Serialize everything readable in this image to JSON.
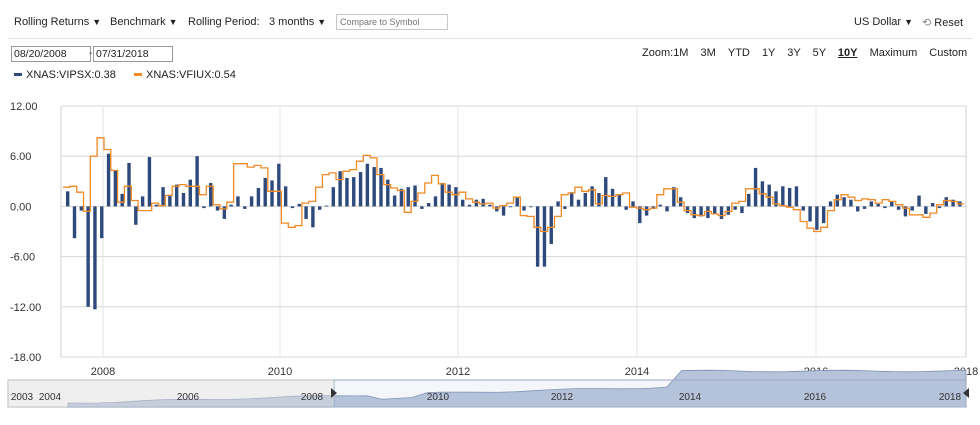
{
  "toolbar": {
    "rolling_returns": "Rolling Returns",
    "benchmark": "Benchmark",
    "rolling_period_label": "Rolling Period:",
    "rolling_period_value": "3 months",
    "compare_placeholder": "Compare to Symbol",
    "currency": "US Dollar",
    "reset": "Reset"
  },
  "dates": {
    "start": "08/20/2008",
    "end": "07/31/2018"
  },
  "zoom": {
    "label": "Zoom:",
    "options": [
      "1M",
      "3M",
      "YTD",
      "1Y",
      "3Y",
      "5Y",
      "10Y",
      "Maximum",
      "Custom"
    ],
    "active": "10Y"
  },
  "legend": [
    {
      "label": "XNAS:VIPSX:0.38",
      "color": "#2e4a7d"
    },
    {
      "label": "XNAS:VFIUX:0.54",
      "color": "#f08a24"
    }
  ],
  "colors": {
    "vipsx": "#2e4a7d",
    "vfiux": "#f08a24",
    "navigator_fill": "#b6c3da"
  },
  "chart_data": {
    "type": "bar",
    "title": "",
    "xlabel": "",
    "ylabel": "",
    "ylim": [
      -18,
      12
    ],
    "y_ticks": [
      "12.00",
      "6.00",
      "0.00",
      "-6.00",
      "-12.00",
      "-18.00"
    ],
    "x_ticks": [
      "2008",
      "2010",
      "2012",
      "2014",
      "2016",
      "2018"
    ],
    "grid": true,
    "legend_position": "top-left",
    "series": [
      {
        "name": "XNAS:VIPSX:0.38",
        "type": "bar",
        "values": [
          1.8,
          -3.8,
          -0.5,
          -12,
          -12.3,
          -3.8,
          6.3,
          4.3,
          1.5,
          5.2,
          -2.2,
          1.2,
          5.9,
          0.2,
          2.3,
          1.4,
          2.6,
          1.6,
          3.2,
          6,
          -0.2,
          2.8,
          -0.5,
          -1.5,
          0.2,
          1.2,
          -0.3,
          1.2,
          2.2,
          3.4,
          3.1,
          5.1,
          2.4,
          -0.2,
          0.3,
          -1.5,
          -2.5,
          -0.4,
          0.1,
          2.3,
          4.2,
          3.4,
          3.5,
          4.1,
          5.1,
          4.7,
          4.6,
          3.2,
          1.3,
          2.1,
          2.3,
          2.5,
          -0.3,
          0.4,
          1.2,
          2.8,
          2.6,
          2.3,
          0.8,
          0.2,
          0.8,
          0.9,
          0.2,
          -0.6,
          -1.1,
          -0.1,
          1.1,
          -0.5,
          -0.1,
          -7.2,
          -7.2,
          -4.5,
          0.6,
          -0.3,
          1.7,
          0.8,
          1.6,
          2.4,
          1.6,
          3.5,
          2.1,
          1.4,
          -0.4,
          0.6,
          -2,
          -1.1,
          -0.3,
          0.2,
          -0.6,
          2.3,
          1.1,
          -0.8,
          -1.4,
          -1.2,
          -1.4,
          -0.9,
          -1.5,
          -1,
          -0.4,
          -0.8,
          1.5,
          4.6,
          3,
          2.6,
          1.8,
          2.4,
          2.2,
          2.4,
          -0.5,
          -1.8,
          -2.8,
          -2,
          0.6,
          1.4,
          1.1,
          0.8,
          -0.6,
          -0.3,
          0.6,
          0.3,
          -0.2,
          0.6,
          -0.4,
          -1.2,
          -0.5,
          1.3,
          -0.9,
          0.4,
          -0.2,
          1.1,
          0.8,
          0.6
        ]
      },
      {
        "name": "XNAS:VFIUX:0.54",
        "type": "step",
        "values": [
          2.3,
          2.4,
          1.7,
          -0.6,
          6,
          8.2,
          6.8,
          4.3,
          0.5,
          2.4,
          0.7,
          -0.5,
          -0.5,
          0.4,
          0.1,
          1.3,
          2.4,
          2.6,
          2.4,
          2.4,
          1.4,
          2.4,
          0.2,
          -0.3,
          0.5,
          5.1,
          5.1,
          4.7,
          4.9,
          4.6,
          1.8,
          1.8,
          -2,
          -2.5,
          -2.3,
          0.4,
          0.6,
          2.3,
          3.8,
          4,
          3.2,
          4.2,
          4.4,
          5.4,
          6.1,
          5.8,
          3.8,
          2.6,
          2.2,
          1.9,
          -0.7,
          0.6,
          1.6,
          2.8,
          3.7,
          2.7,
          1.7,
          1.4,
          1.7,
          0.9,
          0.5,
          0.3,
          0.4,
          -0.2,
          0.1,
          0.4,
          1.1,
          -1.1,
          -1.2,
          -2.5,
          -3,
          -2.5,
          -1.2,
          1.4,
          1.6,
          2.3,
          1.8,
          2,
          0.3,
          1.3,
          1.2,
          1.4,
          1.6,
          -0.1,
          -0.2,
          -0.4,
          -0.2,
          1.4,
          2.1,
          2.1,
          0.5,
          -0.5,
          -1,
          -1.1,
          -0.6,
          -0.9,
          -1.1,
          -0.6,
          0.4,
          0.6,
          2.1,
          2.1,
          1.5,
          1.1,
          0.3,
          0.1,
          -0.1,
          -0.4,
          -1.8,
          -2.6,
          -3,
          -2.5,
          -0.5,
          0.8,
          1.4,
          1.1,
          0.7,
          0.9,
          0.8,
          0.4,
          0.8,
          0.6,
          0.2,
          -0.2,
          -1,
          -1,
          -1.3,
          -0.8,
          0.2,
          0.7,
          0.6,
          0.3
        ]
      }
    ]
  },
  "navigator": {
    "labels": [
      "2003",
      "2004",
      "2006",
      "2008",
      "2010",
      "2012",
      "2014",
      "2016",
      "2018"
    ]
  }
}
